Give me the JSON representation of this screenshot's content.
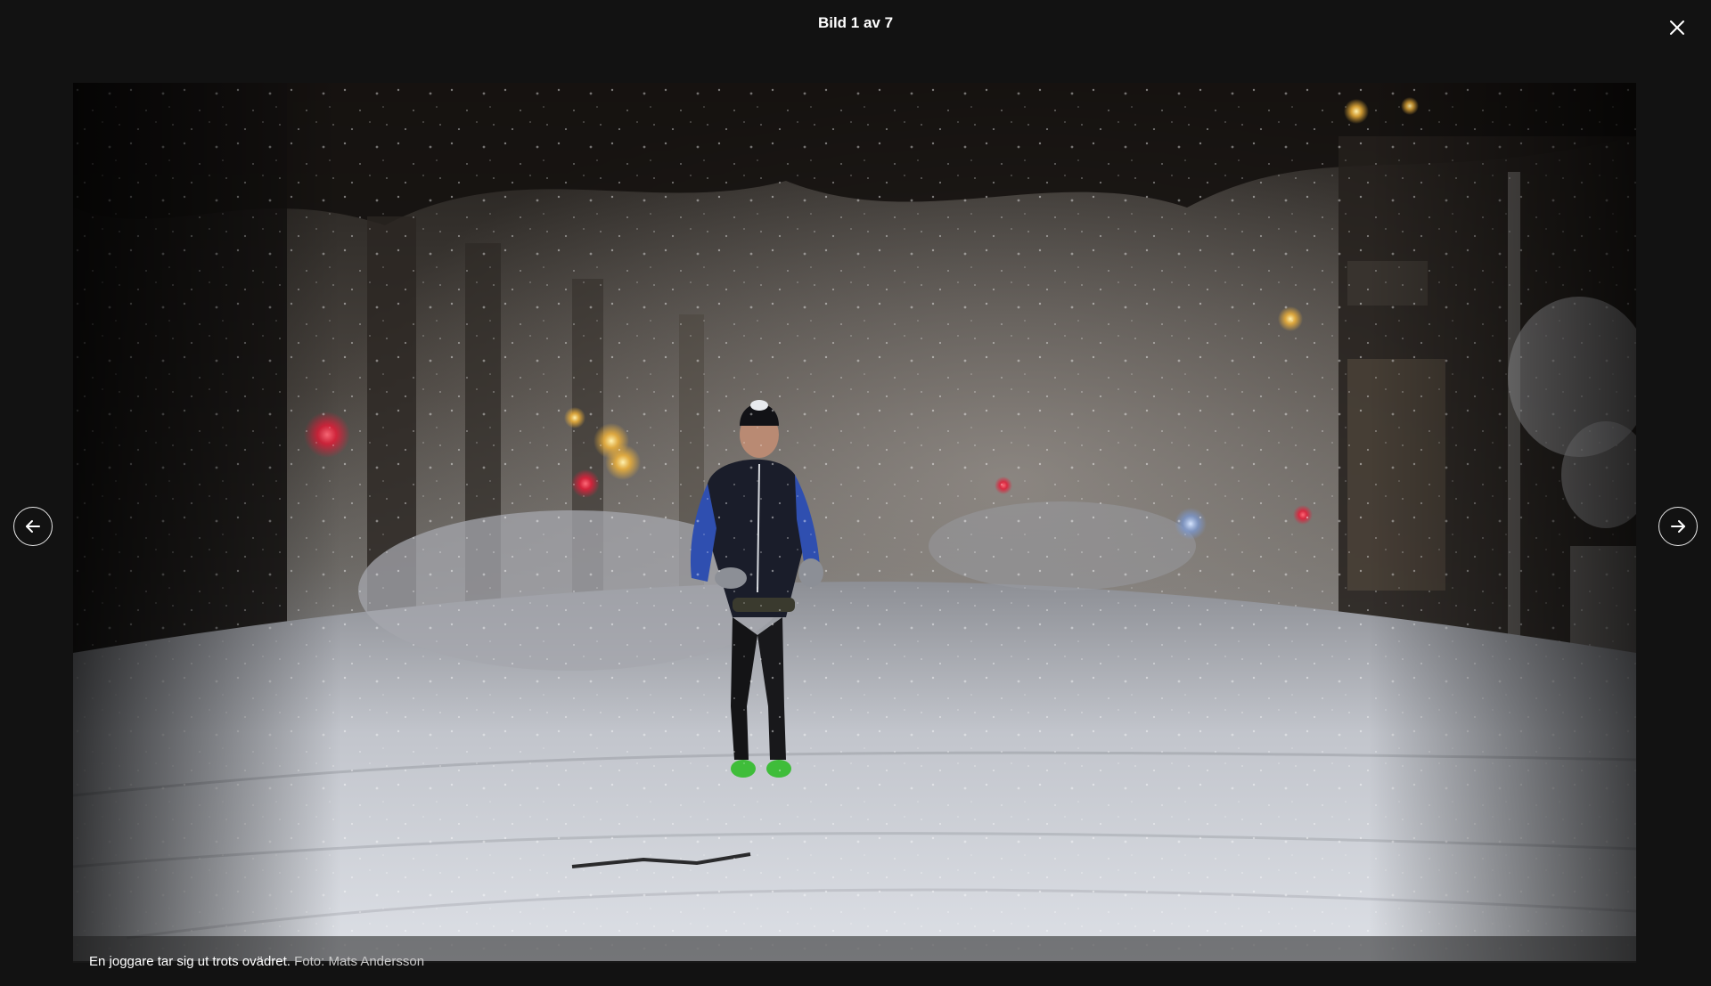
{
  "viewer": {
    "counter_text": "Bild 1 av 7",
    "close_icon": "close-icon",
    "prev_icon": "arrow-left-icon",
    "next_icon": "arrow-right-icon"
  },
  "photo": {
    "caption": "En joggare tar sig ut trots ovädret.",
    "credit": "Foto: Mats Andersson"
  },
  "colors": {
    "background": "#121212",
    "text": "#ffffff",
    "credit_text": "#c8c8c8"
  }
}
